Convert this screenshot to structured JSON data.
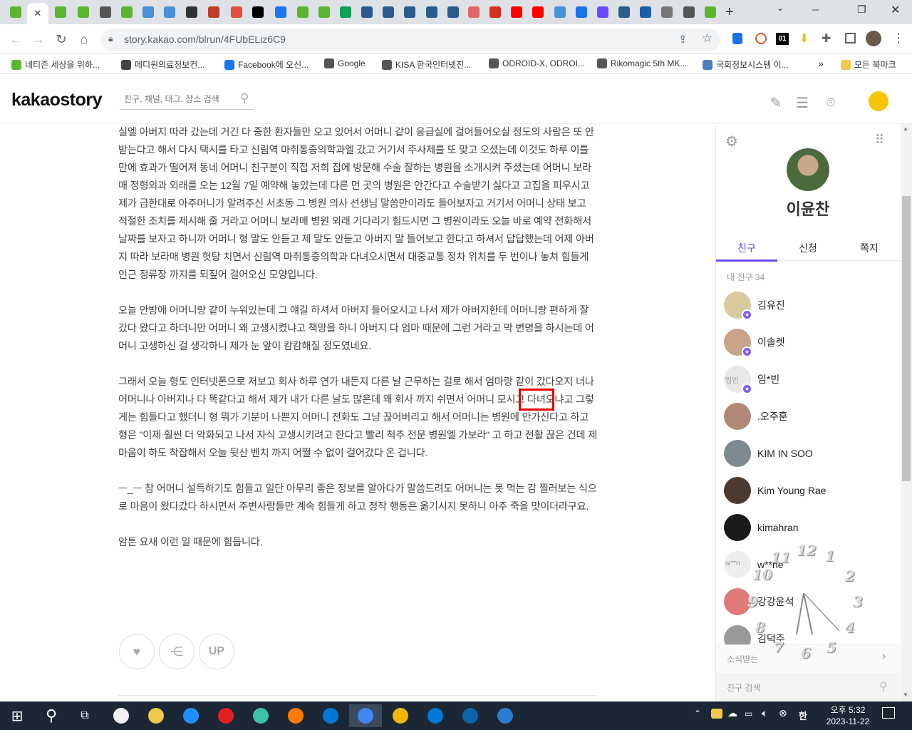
{
  "browser": {
    "url": "story.kakao.com/blrun/4FUbELiz6C9",
    "new_tab": "+",
    "window_controls": [
      "─",
      "❐",
      "✕"
    ]
  },
  "bookmarks": [
    {
      "label": "네티즌 세상을 위하...",
      "color": "#5cb531"
    },
    {
      "label": "메디원의료정보컨...",
      "color": "#444"
    },
    {
      "label": "Facebook에 오신...",
      "color": "#1877f2"
    },
    {
      "label": "Google",
      "color": "#555"
    },
    {
      "label": "KISA 한국인터넷진...",
      "color": "#555"
    },
    {
      "label": "ODROID-X, ODROI...",
      "color": "#555"
    },
    {
      "label": "Rikomagic 5th MK...",
      "color": "#555"
    },
    {
      "label": "국회정보시스템 이...",
      "color": "#4a7fc1"
    },
    {
      "label": "모든 북마크",
      "color": "#f2c94c"
    }
  ],
  "header": {
    "logo": "kakaostory",
    "search_placeholder": "친구, 채널, 태그, 장소 검색"
  },
  "article": {
    "paragraphs": [
      "실엘 아버지 따라 갔는데 거긴 다 중한 환자들만 오고 있어서 어머니 같이 응급실에 걸어들어오실 정도의 사람은 또 안받는다고 해서 다시 택시를 타고 신림역 마취통증의학과엘 갔고 거기서 주사제를 또 맞고 오셨는데 이것도 하루 이틀 만에 효과가 떨어져 동네 어머니 친구분이 직접 저희 집에 방문해 수술 잘하는 병원을 소개시켜 주셨는데 어머니 보라매 정형외과 외래를 오는 12월 7일 예약해 놓았는데 다른 먼 곳의 병원은 안간다고 수술받기 싫다고 고집을 피우시고 제가 급한대로 아주머니가 알려주신 서초동 그 병원 의사 선생님 말씀만이라도 들어보자고 거기서 어머니 상태 보고 적절한 조치를 제시해 줄 거라고 어머니 보라매 병원 외래 기다리기 힘드시면 그 병원이라도 오늘 바로 예약 전화해서 날짜를 보자고 하니까 어머니 형 말도 안듣고 제 말도 안듣고 아버지 말 들어보고 한다고 하셔서 답답했는데 어제 아버지 따라 보라매 병원 헛탕 치면서 신림역 마취통증의학과 다녀오시면서 대중교통 정차 위치를 두 번이나 놓쳐 힘들게 인근 정류장 까지를 되짚어 걸어오신 모양입니다.",
      "오늘 안방에 어머니랑 같이 누워있는데 그 얘길 하셔서 아버지 들어오시고 나서 제가 아버지한테 어머니랑 편하게 잘 갔다 왔다고 하더니만 어머니 왜 고생시켰냐고 책망을 하니 아버지 다 엄마 때문에 그런 거라고 막 변명을 하시는데 어머니 고생하신 걸 생각하니 제가 눈 앞이 캄캄해질 정도였네요.",
      "그래서 오늘 형도 인터넷폰으로 저보고 회사 하루 연가 내든지 다른 날 근무하는 걸로 해서 엄마랑 같이 갔다오지 너나 어머니나 아버지나 다 똑같다고 해서 제가 내가 다른 날도 많은데 왜 회사 까지 쉬면서 어머니 모시고 다녀오냐고 그렇게는 힘들다고 했더니 형 뭐가 기분이 나쁜지 어머니 전화도 그냥 끊어버리고 해서 어머니는 병원에 안가신다고 하고 형은 \"이제 훨씬 더 악화되고 나서 자식 고생시키려고 한다고 빨리 척추 전문 병원엘 가보라\" 고 하고 전활 끊은 건데 제 마음이 하도 착잡해서 오늘 뒷산 벤치 까지 어쩔 수 없이 걸어갔다 온 겁니다.",
      "ㅡ_ㅡ 참 어머니 설득하기도 힘들고 일단 아무리 좋은 정보를 알아다가 말씀드려도 어머니는 못 먹는 감 찔러보는 식으로 마음이 왔다갔다 하시면서 주변사람들만 계속 힘들게 하고 정작 행동은 옮기시지 못하니 아주 죽을 맛이더라구요.",
      "암튼 요새 이런 일 때문에 힘듭니다."
    ],
    "highlight_word": "엄마랑",
    "up_label": "UP"
  },
  "sidebar": {
    "profile_name": "이윤찬",
    "tabs": [
      "친구",
      "신청",
      "쪽지"
    ],
    "friends_count": "내 친구 34",
    "friends": [
      {
        "name": "김유진",
        "star": true,
        "color": "#d8c9a0"
      },
      {
        "name": "이솔렛",
        "star": true,
        "color": "#c7a48a"
      },
      {
        "name": "임*빈",
        "star": true,
        "color": "#e8e8e8",
        "initials": "임빈"
      },
      {
        "name": ".오주훈",
        "star": false,
        "color": "#b08878"
      },
      {
        "name": "KIM IN SOO",
        "star": false,
        "color": "#7d8a8f"
      },
      {
        "name": "Kim Young Rae",
        "star": false,
        "color": "#4a3a2f"
      },
      {
        "name": "kimahran",
        "star": false,
        "color": "#1a1a1a"
      },
      {
        "name": "w**ne",
        "star": false,
        "color": "#eeeeee",
        "initials": "w**n"
      },
      {
        "name": "강강윤석",
        "star": false,
        "color": "#e07a7a"
      },
      {
        "name": "김덕주",
        "star": false,
        "color": "#999"
      }
    ],
    "news_label": "소식받는",
    "friend_search_placeholder": "친구 검색"
  },
  "clock": {
    "numbers": [
      "12",
      "1",
      "2",
      "3",
      "4",
      "5",
      "6",
      "7",
      "8",
      "9",
      "10",
      "11"
    ]
  },
  "taskbar": {
    "time": "오후 5:32",
    "date": "2023-11-22",
    "ime": "한"
  }
}
